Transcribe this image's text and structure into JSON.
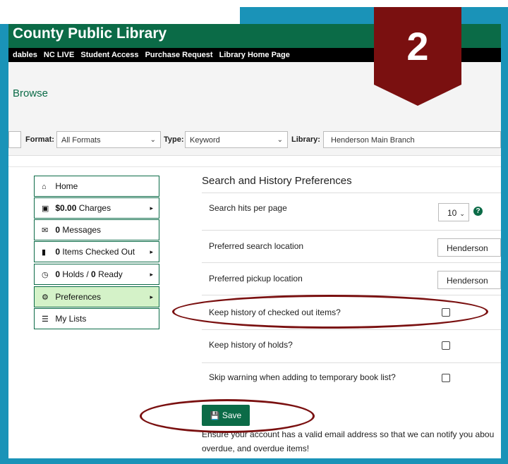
{
  "header": {
    "title": "County Public Library"
  },
  "nav": {
    "links": [
      "dables",
      "NC LIVE",
      "Student Access",
      "Purchase Request",
      "Library Home Page"
    ]
  },
  "browse": {
    "label": "Browse"
  },
  "filters": {
    "format_label": "Format:",
    "format_value": "All Formats",
    "type_label": "Type:",
    "type_value": "Keyword",
    "library_label": "Library:",
    "library_value": "Henderson Main Branch"
  },
  "sidebar": {
    "items": [
      {
        "icon": "home-icon",
        "label": "Home"
      },
      {
        "icon": "money-icon",
        "label": "$0.00 Charges",
        "bold": "$0.00",
        "rest": " Charges"
      },
      {
        "icon": "envelope-icon",
        "label": "0 Messages",
        "bold": "0",
        "rest": " Messages"
      },
      {
        "icon": "book-icon",
        "label": "0 Items Checked Out",
        "bold": "0",
        "rest": " Items Checked Out"
      },
      {
        "icon": "clock-icon",
        "label": "0 Holds / 0 Ready",
        "bold1": "0",
        "mid": " Holds / ",
        "bold2": "0",
        "rest": " Ready"
      },
      {
        "icon": "gear-icon",
        "label": "Preferences"
      },
      {
        "icon": "list-icon",
        "label": "My Lists"
      }
    ]
  },
  "prefs": {
    "title": "Search and History Preferences",
    "hits_label": "Search hits per page",
    "hits_value": "10",
    "search_loc_label": "Preferred search location",
    "search_loc_value": "Henderson",
    "pickup_label": "Preferred pickup location",
    "pickup_value": "Henderson",
    "keep_checkout_label": "Keep history of checked out items?",
    "keep_holds_label": "Keep history of holds?",
    "skip_warning_label": "Skip warning when adding to temporary book list?",
    "save_label": "Save",
    "notice": "Ensure your account has a valid email address so that we can notify you abou overdue, and overdue items!"
  },
  "badge": {
    "number": "2"
  },
  "colors": {
    "brand_green": "#0b6b47",
    "badge_red": "#7a1010",
    "frame_teal": "#1a93b8",
    "active_green": "#d4f2c8"
  }
}
